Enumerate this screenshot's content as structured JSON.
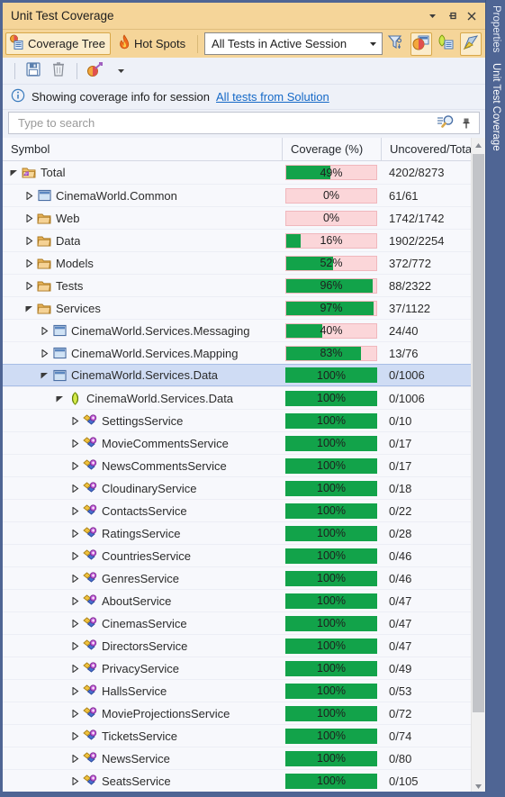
{
  "window": {
    "title": "Unit Test Coverage",
    "controls": [
      {
        "name": "dropdown-menu",
        "glyph": "▼"
      },
      {
        "name": "pin",
        "glyph": "pin"
      },
      {
        "name": "close",
        "glyph": "✕"
      }
    ]
  },
  "dock": {
    "tabs": [
      {
        "label": "Properties",
        "active": false
      },
      {
        "label": "Unit Test Coverage",
        "active": true
      }
    ]
  },
  "toolbar": {
    "coverage_tree_label": "Coverage Tree",
    "hot_spots_label": "Hot Spots",
    "session_combo_value": "All Tests in Active Session",
    "filter_icon": "filter-icon",
    "show_covered_icon": "show-covered-icon",
    "group_icon": "group-icon",
    "highlight_icon": "highlight-editor-icon",
    "export_icon": "save-icon",
    "delete_icon": "trash-icon",
    "snapshot_icon": "coverage-snapshot-icon",
    "snapshot_dropdown_glyph": "▾"
  },
  "infobar": {
    "icon": "info-icon",
    "text": "Showing coverage info for session",
    "link": "All tests from Solution"
  },
  "search": {
    "placeholder": "Type to search",
    "value": "",
    "search_icon": "search-icon",
    "pin_icon": "pin-icon"
  },
  "grid": {
    "columns": [
      "Symbol",
      "Coverage (%)",
      "Uncovered/Total"
    ],
    "rows": [
      {
        "label": "Total",
        "indent": 0,
        "twisty": "expanded",
        "icon": "total-icon",
        "pct": "49%",
        "fill": 49,
        "uncovered": "4202/8273",
        "selected": false
      },
      {
        "label": "CinemaWorld.Common",
        "indent": 1,
        "twisty": "collapsed",
        "icon": "assembly-icon",
        "pct": "0%",
        "fill": 0,
        "uncovered": "61/61",
        "selected": false
      },
      {
        "label": "Web",
        "indent": 1,
        "twisty": "collapsed",
        "icon": "folder-icon",
        "pct": "0%",
        "fill": 0,
        "uncovered": "1742/1742",
        "selected": false
      },
      {
        "label": "Data",
        "indent": 1,
        "twisty": "collapsed",
        "icon": "folder-icon",
        "pct": "16%",
        "fill": 16,
        "uncovered": "1902/2254",
        "selected": false
      },
      {
        "label": "Models",
        "indent": 1,
        "twisty": "collapsed",
        "icon": "folder-icon",
        "pct": "52%",
        "fill": 52,
        "uncovered": "372/772",
        "selected": false
      },
      {
        "label": "Tests",
        "indent": 1,
        "twisty": "collapsed",
        "icon": "folder-icon",
        "pct": "96%",
        "fill": 96,
        "uncovered": "88/2322",
        "selected": false
      },
      {
        "label": "Services",
        "indent": 1,
        "twisty": "expanded",
        "icon": "folder-icon",
        "pct": "97%",
        "fill": 97,
        "uncovered": "37/1122",
        "selected": false
      },
      {
        "label": "CinemaWorld.Services.Messaging",
        "indent": 2,
        "twisty": "collapsed",
        "icon": "assembly-icon",
        "pct": "40%",
        "fill": 40,
        "uncovered": "24/40",
        "selected": false
      },
      {
        "label": "CinemaWorld.Services.Mapping",
        "indent": 2,
        "twisty": "collapsed",
        "icon": "assembly-icon",
        "pct": "83%",
        "fill": 83,
        "uncovered": "13/76",
        "selected": false
      },
      {
        "label": "CinemaWorld.Services.Data",
        "indent": 2,
        "twisty": "expanded",
        "icon": "assembly-icon",
        "pct": "100%",
        "fill": 100,
        "uncovered": "0/1006",
        "selected": true
      },
      {
        "label": "CinemaWorld.Services.Data",
        "indent": 3,
        "twisty": "expanded",
        "icon": "namespace-icon",
        "pct": "100%",
        "fill": 100,
        "uncovered": "0/1006",
        "selected": false
      },
      {
        "label": "SettingsService",
        "indent": 4,
        "twisty": "collapsed",
        "icon": "class-icon",
        "pct": "100%",
        "fill": 100,
        "uncovered": "0/10",
        "selected": false
      },
      {
        "label": "MovieCommentsService",
        "indent": 4,
        "twisty": "collapsed",
        "icon": "class-icon",
        "pct": "100%",
        "fill": 100,
        "uncovered": "0/17",
        "selected": false
      },
      {
        "label": "NewsCommentsService",
        "indent": 4,
        "twisty": "collapsed",
        "icon": "class-icon",
        "pct": "100%",
        "fill": 100,
        "uncovered": "0/17",
        "selected": false
      },
      {
        "label": "CloudinaryService",
        "indent": 4,
        "twisty": "collapsed",
        "icon": "class-icon",
        "pct": "100%",
        "fill": 100,
        "uncovered": "0/18",
        "selected": false
      },
      {
        "label": "ContactsService",
        "indent": 4,
        "twisty": "collapsed",
        "icon": "class-icon",
        "pct": "100%",
        "fill": 100,
        "uncovered": "0/22",
        "selected": false
      },
      {
        "label": "RatingsService",
        "indent": 4,
        "twisty": "collapsed",
        "icon": "class-icon",
        "pct": "100%",
        "fill": 100,
        "uncovered": "0/28",
        "selected": false
      },
      {
        "label": "CountriesService",
        "indent": 4,
        "twisty": "collapsed",
        "icon": "class-icon",
        "pct": "100%",
        "fill": 100,
        "uncovered": "0/46",
        "selected": false
      },
      {
        "label": "GenresService",
        "indent": 4,
        "twisty": "collapsed",
        "icon": "class-icon",
        "pct": "100%",
        "fill": 100,
        "uncovered": "0/46",
        "selected": false
      },
      {
        "label": "AboutService",
        "indent": 4,
        "twisty": "collapsed",
        "icon": "class-icon",
        "pct": "100%",
        "fill": 100,
        "uncovered": "0/47",
        "selected": false
      },
      {
        "label": "CinemasService",
        "indent": 4,
        "twisty": "collapsed",
        "icon": "class-icon",
        "pct": "100%",
        "fill": 100,
        "uncovered": "0/47",
        "selected": false
      },
      {
        "label": "DirectorsService",
        "indent": 4,
        "twisty": "collapsed",
        "icon": "class-icon",
        "pct": "100%",
        "fill": 100,
        "uncovered": "0/47",
        "selected": false
      },
      {
        "label": "PrivacyService",
        "indent": 4,
        "twisty": "collapsed",
        "icon": "class-icon",
        "pct": "100%",
        "fill": 100,
        "uncovered": "0/49",
        "selected": false
      },
      {
        "label": "HallsService",
        "indent": 4,
        "twisty": "collapsed",
        "icon": "class-icon",
        "pct": "100%",
        "fill": 100,
        "uncovered": "0/53",
        "selected": false
      },
      {
        "label": "MovieProjectionsService",
        "indent": 4,
        "twisty": "collapsed",
        "icon": "class-icon",
        "pct": "100%",
        "fill": 100,
        "uncovered": "0/72",
        "selected": false
      },
      {
        "label": "TicketsService",
        "indent": 4,
        "twisty": "collapsed",
        "icon": "class-icon",
        "pct": "100%",
        "fill": 100,
        "uncovered": "0/74",
        "selected": false
      },
      {
        "label": "NewsService",
        "indent": 4,
        "twisty": "collapsed",
        "icon": "class-icon",
        "pct": "100%",
        "fill": 100,
        "uncovered": "0/80",
        "selected": false
      },
      {
        "label": "SeatsService",
        "indent": 4,
        "twisty": "collapsed",
        "icon": "class-icon",
        "pct": "100%",
        "fill": 100,
        "uncovered": "0/105",
        "selected": false
      }
    ]
  },
  "colors": {
    "title_bar": "#f5d599",
    "covered_green": "#12a34a",
    "uncovered_pink": "#fbd6d9",
    "selection_blue": "#cfdcf4",
    "dock_blue": "#4f6594",
    "link_blue": "#1569c7"
  }
}
